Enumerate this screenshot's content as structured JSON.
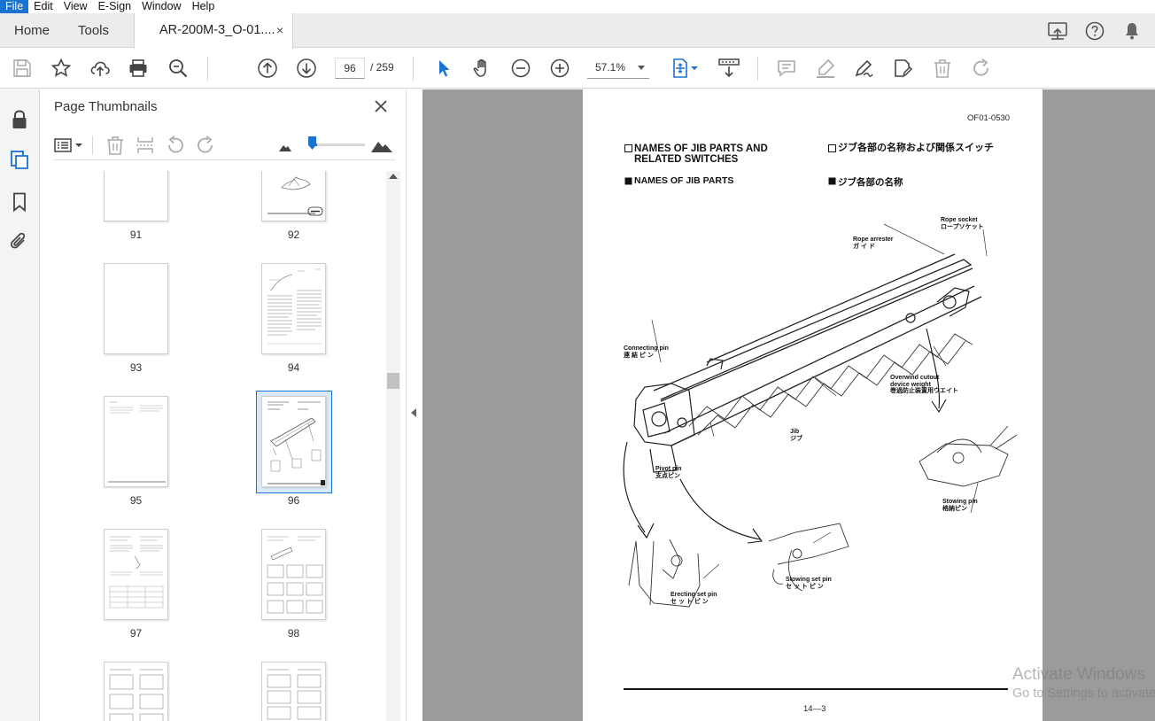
{
  "menu": {
    "file": "File",
    "edit": "Edit",
    "view": "View",
    "esign": "E-Sign",
    "window": "Window",
    "help": "Help"
  },
  "tabs": {
    "home": "Home",
    "tools": "Tools",
    "document_title": "AR-200M-3_O-01....",
    "close_glyph": "×"
  },
  "toolbar": {
    "current_page": "96",
    "page_total": "/ 259",
    "zoom": "57.1%"
  },
  "thumbnails_panel": {
    "title": "Page Thumbnails",
    "pages": [
      {
        "label": "91"
      },
      {
        "label": "92"
      },
      {
        "label": "93"
      },
      {
        "label": "94"
      },
      {
        "label": "95"
      },
      {
        "label": "96",
        "selected": true
      },
      {
        "label": "97"
      },
      {
        "label": "98"
      }
    ]
  },
  "document": {
    "code": "OF01-0530",
    "heading_en_1": "NAMES OF JIB PARTS AND",
    "heading_en_2": "RELATED SWITCHES",
    "heading_jp": "ジブ各部の名称および関係スイッチ",
    "sub_en": "NAMES OF JIB PARTS",
    "sub_jp": "ジブ各部の名称",
    "labels": {
      "rope_socket": "Rope socket",
      "rope_socket_jp": "ロープソケット",
      "rope_arrester": "Rope arrester",
      "rope_arrester_jp": "ガ イ ド",
      "connecting_pin": "Connecting pin",
      "connecting_pin_jp": "連 結 ピ ン",
      "overwind_1": "Overwind cutout",
      "overwind_2": "device weight",
      "overwind_jp": "巻過防止装置用ウエイト",
      "jib": "Jib",
      "jib_jp": "ジブ",
      "pivot_pin": "Pivot pin",
      "pivot_pin_jp": "支点ピン",
      "stowing_pin": "Stowing pin",
      "stowing_pin_jp": "格納ピン",
      "erecting_set_pin": "Erecting set pin",
      "erecting_set_pin_jp": "セ ッ ト ピ ン",
      "stowing_set_pin": "Stowing set pin",
      "stowing_set_pin_jp": "セ ッ ト ピ ン"
    },
    "page_number": "14—3"
  },
  "watermark": {
    "line1": "Activate Windows",
    "line2": "Go to Settings to activate"
  },
  "colors": {
    "accent": "#1a73d1",
    "chrome": "#ececec",
    "doc_background": "#9b9b9b"
  }
}
